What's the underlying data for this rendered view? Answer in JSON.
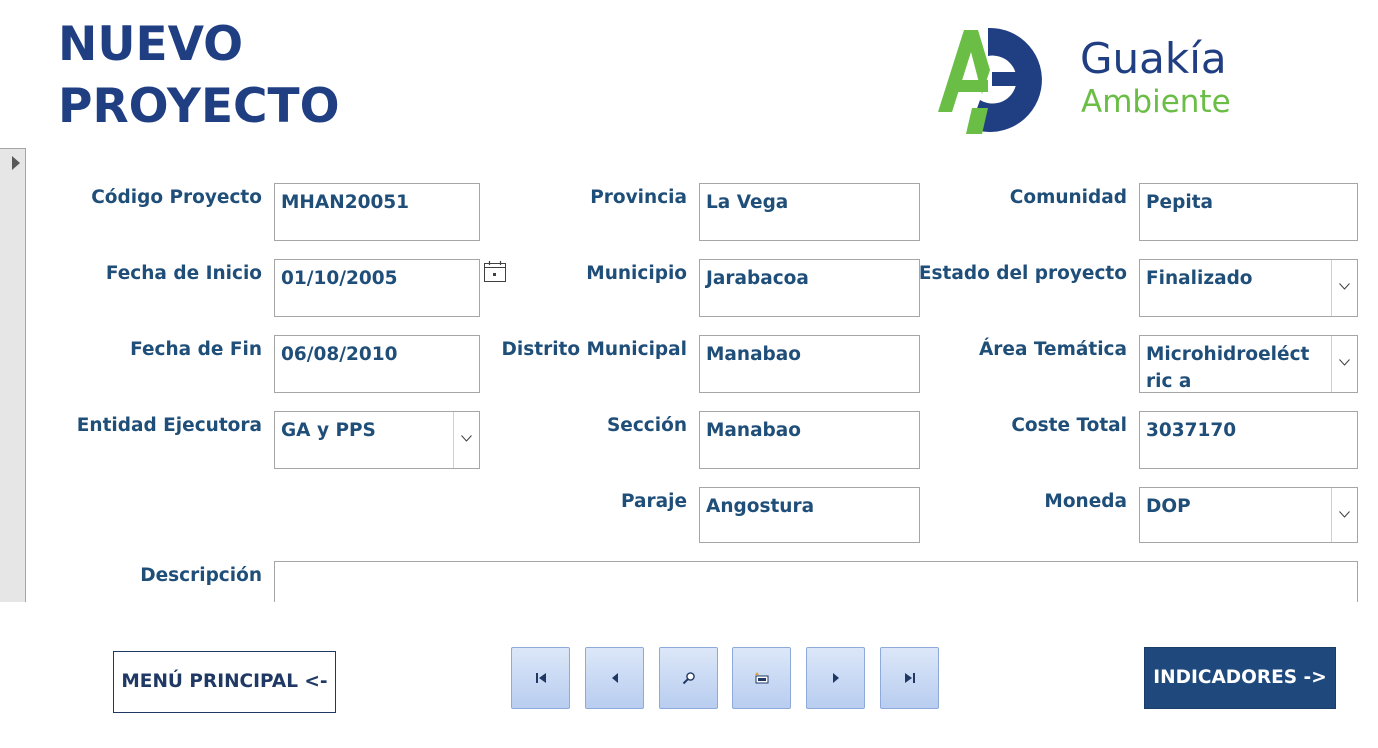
{
  "header": {
    "title_line1": "NUEVO",
    "title_line2": "PROYECTO",
    "logo_name": "Guakía",
    "logo_sub": "Ambiente",
    "logo_colors": {
      "green": "#6abd45",
      "blue": "#203e82"
    }
  },
  "form": {
    "codigo": {
      "label": "Código Proyecto",
      "value": "MHAN20051"
    },
    "fecha_inicio": {
      "label": "Fecha de Inicio",
      "value": "01/10/2005"
    },
    "fecha_fin": {
      "label": "Fecha de Fin",
      "value": "06/08/2010"
    },
    "entidad": {
      "label": "Entidad Ejecutora",
      "value": "GA y PPS"
    },
    "provincia": {
      "label": "Provincia",
      "value": "La Vega"
    },
    "municipio": {
      "label": "Municipio",
      "value": "Jarabacoa"
    },
    "distrito": {
      "label": "Distrito Municipal",
      "value": "Manabao"
    },
    "seccion": {
      "label": "Sección",
      "value": "Manabao"
    },
    "paraje": {
      "label": "Paraje",
      "value": "Angostura"
    },
    "comunidad": {
      "label": "Comunidad",
      "value": "Pepita"
    },
    "estado": {
      "label": "Estado del proyecto",
      "value": "Finalizado"
    },
    "area": {
      "label": "Área Temática",
      "value": "Microhidroeléctric a"
    },
    "coste": {
      "label": "Coste Total",
      "value": "3037170"
    },
    "moneda": {
      "label": "Moneda",
      "value": "DOP"
    },
    "descripcion": {
      "label": "Descripción",
      "value": ""
    }
  },
  "buttons": {
    "menu_principal": "MENÚ PRINCIPAL <-",
    "indicadores": "INDICADORES ->"
  },
  "navigation_icons": [
    "first-record-icon",
    "previous-record-icon",
    "search-icon",
    "new-record-icon",
    "next-record-icon",
    "last-record-icon"
  ],
  "colors": {
    "label_text": "#1f4e79",
    "title": "#203e82",
    "primary_button": "#1f497d"
  }
}
